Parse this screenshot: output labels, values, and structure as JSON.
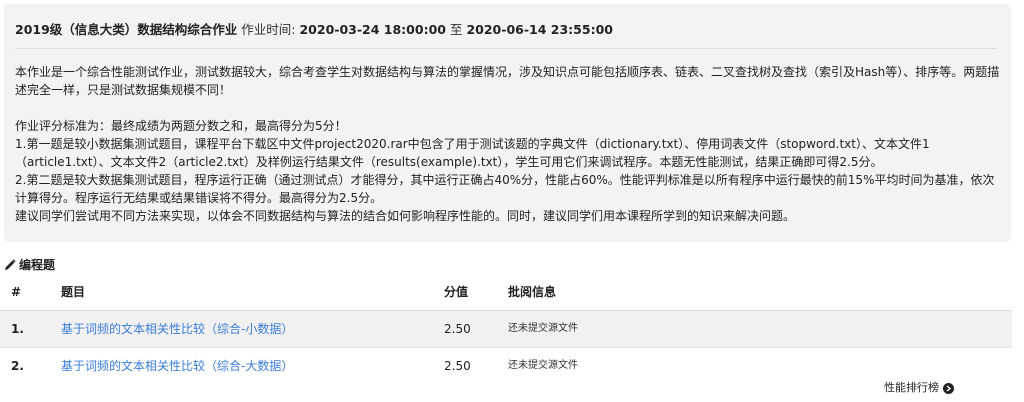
{
  "assignment": {
    "title": "2019级（信息大类）数据结构综合作业",
    "time_label": "作业时间:",
    "start": "2020-03-24 18:00:00",
    "to": "至",
    "end": "2020-06-14 23:55:00"
  },
  "description": {
    "intro": "本作业是一个综合性能测试作业，测试数据较大，综合考查学生对数据结构与算法的掌握情况，涉及知识点可能包括顺序表、链表、二叉查找树及查找（索引及Hash等）、排序等。两题描述完全一样，只是测试数据集规模不同！",
    "criteria_title": "作业评分标准为：最终成绩为两题分数之和，最高得分为5分！",
    "item1": "1.第一题是较小数据集测试题目，课程平台下载区中文件project2020.rar中包含了用于测试该题的字典文件（dictionary.txt）、停用词表文件（stopword.txt）、文本文件1（article1.txt）、文本文件2（article2.txt）及样例运行结果文件（results(example).txt），学生可用它们来调试程序。本题无性能测试，结果正确即可得2.5分。",
    "item2": "2.第二题是较大数据集测试题目，程序运行正确（通过测试点）才能得分，其中运行正确占40%分，性能占60%。性能评判标准是以所有程序中运行最快的前15%平均时间为基准，依次计算得分。程序运行无结果或结果错误将不得分。最高得分为2.5分。",
    "suggestion": "建议同学们尝试用不同方法来实现，以体会不同数据结构与算法的结合如何影响程序性能的。同时，建议同学们用本课程所学到的知识来解决问题。"
  },
  "section": {
    "title": "编程题",
    "icon": "pencil-icon"
  },
  "table": {
    "headers": {
      "num": "#",
      "title": "题目",
      "score": "分值",
      "info": "批阅信息"
    },
    "rows": [
      {
        "num": "1.",
        "title": "基于词频的文本相关性比较（综合-小数据）",
        "score": "2.50",
        "info": "还未提交源文件"
      },
      {
        "num": "2.",
        "title": "基于词频的文本相关性比较（综合-大数据）",
        "score": "2.50",
        "info": "还未提交源文件"
      }
    ]
  },
  "ranking": {
    "label": "性能排行榜",
    "icon": "arrow-right-circle-icon"
  },
  "colors": {
    "link": "#3b7dd8",
    "panel_bg": "#f3f3f3",
    "row_alt": "#f1f1f1"
  }
}
